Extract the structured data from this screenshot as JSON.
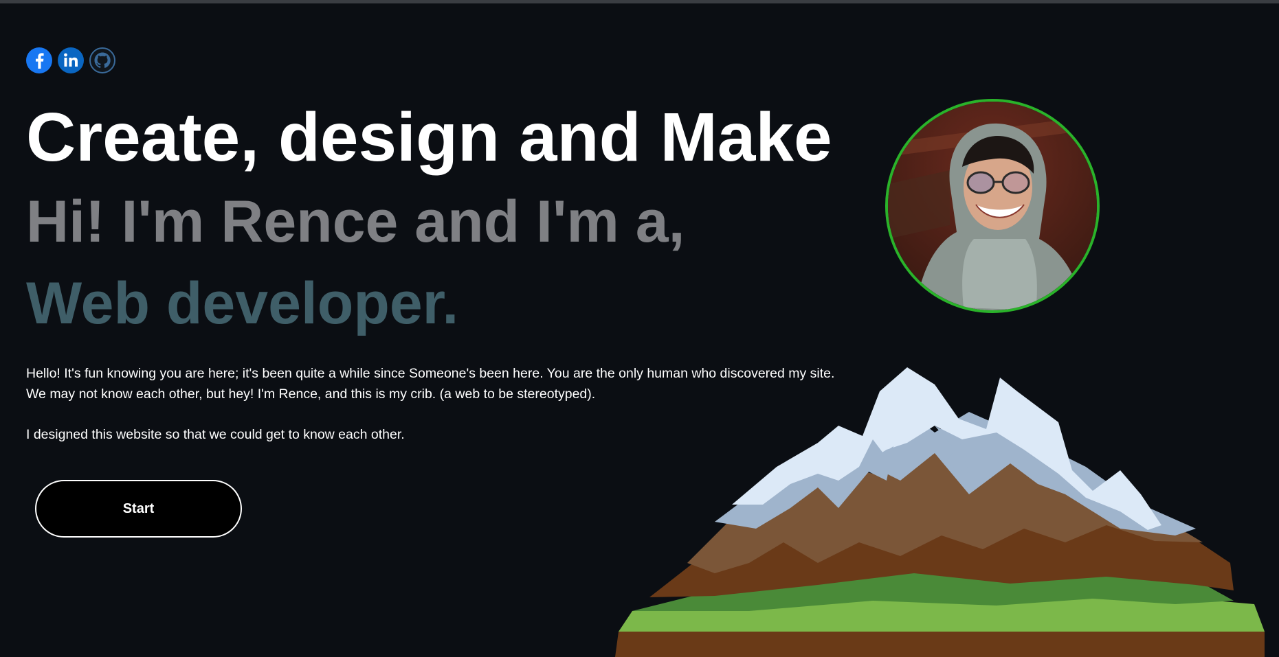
{
  "socials": [
    {
      "name": "facebook",
      "icon": "facebook-icon",
      "color": "#1877f2"
    },
    {
      "name": "linkedin",
      "icon": "linkedin-icon",
      "color": "#0a66c2"
    },
    {
      "name": "github",
      "icon": "github-icon",
      "color": "#1b4a78"
    }
  ],
  "hero": {
    "headline": "Create, design and Make",
    "intro": "Hi! I'm Rence and I'm a,",
    "role": "Web developer.",
    "paragraph1_line1": "Hello! It's fun knowing you are here; it's been quite a while since Someone's been here. You are the only human who discovered my site.",
    "paragraph1_line2": "We may not know each other, but hey! I'm Rence, and this is my crib. (a web to be stereotyped).",
    "paragraph2": "I designed this website so that we could get to know each other.",
    "start_label": "Start"
  },
  "colors": {
    "background": "#0b0e13",
    "headline": "#ffffff",
    "intro": "#7f8084",
    "role": "#3f5e68",
    "avatar_ring": "#2ab32a"
  }
}
